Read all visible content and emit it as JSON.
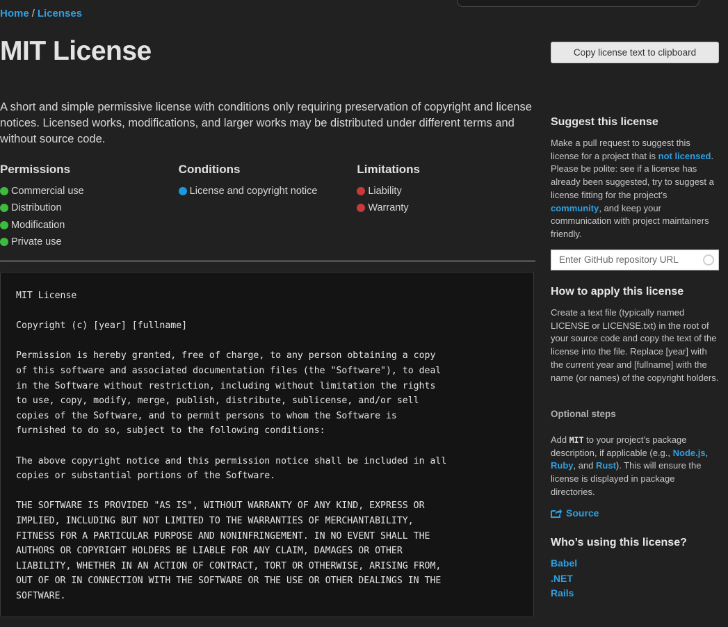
{
  "breadcrumb": {
    "home": "Home",
    "separator": "/",
    "current": "Licenses"
  },
  "title": "MIT License",
  "description": "A short and simple permissive license with conditions only requiring preservation of copyright and license notices. Licensed works, modifications, and larger works may be distributed under different terms and without source code.",
  "rules": {
    "permissions": {
      "heading": "Permissions",
      "color": "#3dbb3d",
      "items": [
        "Commercial use",
        "Distribution",
        "Modification",
        "Private use"
      ]
    },
    "conditions": {
      "heading": "Conditions",
      "color": "#1a98e0",
      "items": [
        "License and copyright notice"
      ]
    },
    "limitations": {
      "heading": "Limitations",
      "color": "#c63a3a",
      "items": [
        "Liability",
        "Warranty"
      ]
    }
  },
  "license_text": "MIT License\n\nCopyright (c) [year] [fullname]\n\nPermission is hereby granted, free of charge, to any person obtaining a copy\nof this software and associated documentation files (the \"Software\"), to deal\nin the Software without restriction, including without limitation the rights\nto use, copy, modify, merge, publish, distribute, sublicense, and/or sell\ncopies of the Software, and to permit persons to whom the Software is\nfurnished to do so, subject to the following conditions:\n\nThe above copyright notice and this permission notice shall be included in all\ncopies or substantial portions of the Software.\n\nTHE SOFTWARE IS PROVIDED \"AS IS\", WITHOUT WARRANTY OF ANY KIND, EXPRESS OR\nIMPLIED, INCLUDING BUT NOT LIMITED TO THE WARRANTIES OF MERCHANTABILITY,\nFITNESS FOR A PARTICULAR PURPOSE AND NONINFRINGEMENT. IN NO EVENT SHALL THE\nAUTHORS OR COPYRIGHT HOLDERS BE LIABLE FOR ANY CLAIM, DAMAGES OR OTHER\nLIABILITY, WHETHER IN AN ACTION OF CONTRACT, TORT OR OTHERWISE, ARISING FROM,\nOUT OF OR IN CONNECTION WITH THE SOFTWARE OR THE USE OR OTHER DEALINGS IN THE\nSOFTWARE.",
  "sidebar": {
    "copy_button": "Copy license text to clipboard",
    "suggest": {
      "heading": "Suggest this license",
      "text_1": "Make a pull request to suggest this license for a project that is ",
      "link_not_licensed": "not licensed",
      "text_2": ". Please be polite: see if a license has already been suggested, try to suggest a license fitting for the project’s ",
      "link_community": "community",
      "text_3": ", and keep your communication with project maintainers friendly.",
      "input_placeholder": "Enter GitHub repository URL"
    },
    "apply": {
      "heading": "How to apply this license",
      "text": "Create a text file (typically named LICENSE or LICENSE.txt) in the root of your source code and copy the text of the license into the file. Replace [year] with the current year and [fullname] with the name (or names) of the copyright holders."
    },
    "optional": {
      "heading": "Optional steps",
      "text_1": "Add ",
      "code": "MIT",
      "text_2": " to your project’s package description, if applicable (e.g., ",
      "link_node": "Node.js",
      "text_3": ", ",
      "link_ruby": "Ruby",
      "text_4": ", and ",
      "link_rust": "Rust",
      "text_5": "). This will ensure the license is displayed in package directories."
    },
    "source_link": "Source",
    "using": {
      "heading": "Who’s using this license?",
      "projects": [
        "Babel",
        ".NET",
        "Rails"
      ]
    }
  },
  "colors": {
    "background": "#212121",
    "link": "#2f9fe0",
    "code_background": "#141414"
  }
}
